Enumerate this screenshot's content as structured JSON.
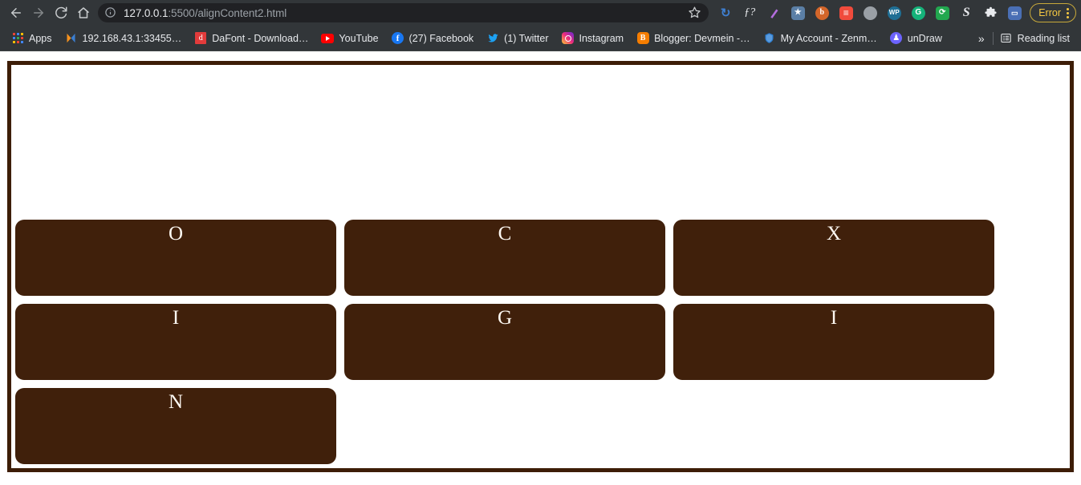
{
  "browser": {
    "nav": {
      "back_label": "Back",
      "forward_label": "Forward",
      "reload_label": "Reload",
      "home_label": "Home"
    },
    "omnibox": {
      "url_host": "127.0.0.1",
      "url_path": ":5500/alignContent2.html",
      "full_url": "127.0.0.1:5500/alignContent2.html",
      "info_icon": "info-circle-icon",
      "bookmark_icon": "star-icon"
    },
    "extensions": [
      {
        "name": "history-back-extension",
        "glyph": "↻",
        "color": "#3f7fd0",
        "shape": "plain"
      },
      {
        "name": "font-finder-extension",
        "glyph": "ƒ?",
        "color": "#e8eaed",
        "shape": "plain"
      },
      {
        "name": "highlighter-extension",
        "glyph": "✎",
        "color": "#b46ede",
        "shape": "plain"
      },
      {
        "name": "screenshot-extension",
        "glyph": "✦",
        "color": "#5b7fa6",
        "shape": "square"
      },
      {
        "name": "bitwarden-extension",
        "glyph": "b",
        "color": "#d4662a",
        "shape": "circle"
      },
      {
        "name": "feedly-extension",
        "glyph": "≋",
        "color": "#f04b3c",
        "shape": "square"
      },
      {
        "name": "grease-extension",
        "glyph": "◍",
        "color": "#9aa0a6",
        "shape": "circle"
      },
      {
        "name": "wordpress-extension",
        "glyph": "WP",
        "color": "#1f6f95",
        "shape": "circle"
      },
      {
        "name": "grammarly-extension",
        "glyph": "G",
        "color": "#15b37a",
        "shape": "circle"
      },
      {
        "name": "sync-extension",
        "glyph": "⟳",
        "color": "#22a84f",
        "shape": "square"
      },
      {
        "name": "sketchy-extension",
        "glyph": "S",
        "color": "#e8eaed",
        "shape": "plain"
      },
      {
        "name": "extensions-puzzle",
        "glyph": "🧩",
        "color": "#e8eaed",
        "shape": "plain"
      },
      {
        "name": "adobe-extension",
        "glyph": "▣",
        "color": "#4a6fb5",
        "shape": "square"
      }
    ],
    "error_chip": {
      "label": "Error",
      "menu_icon": "kebab-menu-icon",
      "border_color": "#c8a93a",
      "text_color": "#f5c842"
    },
    "bookmarks": [
      {
        "name": "apps",
        "label": "Apps",
        "icon": "apps-grid-icon",
        "color": "#4285f4"
      },
      {
        "name": "local-router",
        "label": "192.168.43.1:33455…",
        "icon": "xampp-icon",
        "color": "#f6921e"
      },
      {
        "name": "dafont",
        "label": "DaFont - Download…",
        "icon": "dafont-icon",
        "color": "#e23b3b"
      },
      {
        "name": "youtube",
        "label": "YouTube",
        "icon": "youtube-icon",
        "color": "#ff0000"
      },
      {
        "name": "facebook",
        "label": "(27) Facebook",
        "icon": "facebook-icon",
        "color": "#1877f2"
      },
      {
        "name": "twitter",
        "label": "(1) Twitter",
        "icon": "twitter-icon",
        "color": "#1da1f2"
      },
      {
        "name": "instagram",
        "label": "Instagram",
        "icon": "instagram-icon",
        "color": "#e1306c"
      },
      {
        "name": "blogger",
        "label": "Blogger: Devmein -…",
        "icon": "blogger-icon",
        "color": "#f57d00"
      },
      {
        "name": "zenmate-account",
        "label": "My Account - Zenm…",
        "icon": "zenmate-shield-icon",
        "color": "#2c7fd4"
      },
      {
        "name": "undraw",
        "label": "unDraw",
        "icon": "undraw-icon",
        "color": "#6c63ff"
      }
    ],
    "bookmarks_overflow_label": "»",
    "reading_list": {
      "label": "Reading list",
      "icon": "reading-list-icon"
    }
  },
  "page": {
    "title": "alignContent2",
    "container": {
      "name": "flex-container",
      "border_color": "#3d1d07",
      "background": "#ffffff",
      "align_content": "flex-end",
      "flex_wrap": "wrap"
    },
    "item_style": {
      "background": "#40200b",
      "text_color": "#fdf8f2",
      "border_radius": "11px",
      "font_size": "25px"
    },
    "items": [
      {
        "label": "O"
      },
      {
        "label": "C"
      },
      {
        "label": "X"
      },
      {
        "label": "I"
      },
      {
        "label": "G"
      },
      {
        "label": "I"
      },
      {
        "label": "N"
      }
    ]
  }
}
